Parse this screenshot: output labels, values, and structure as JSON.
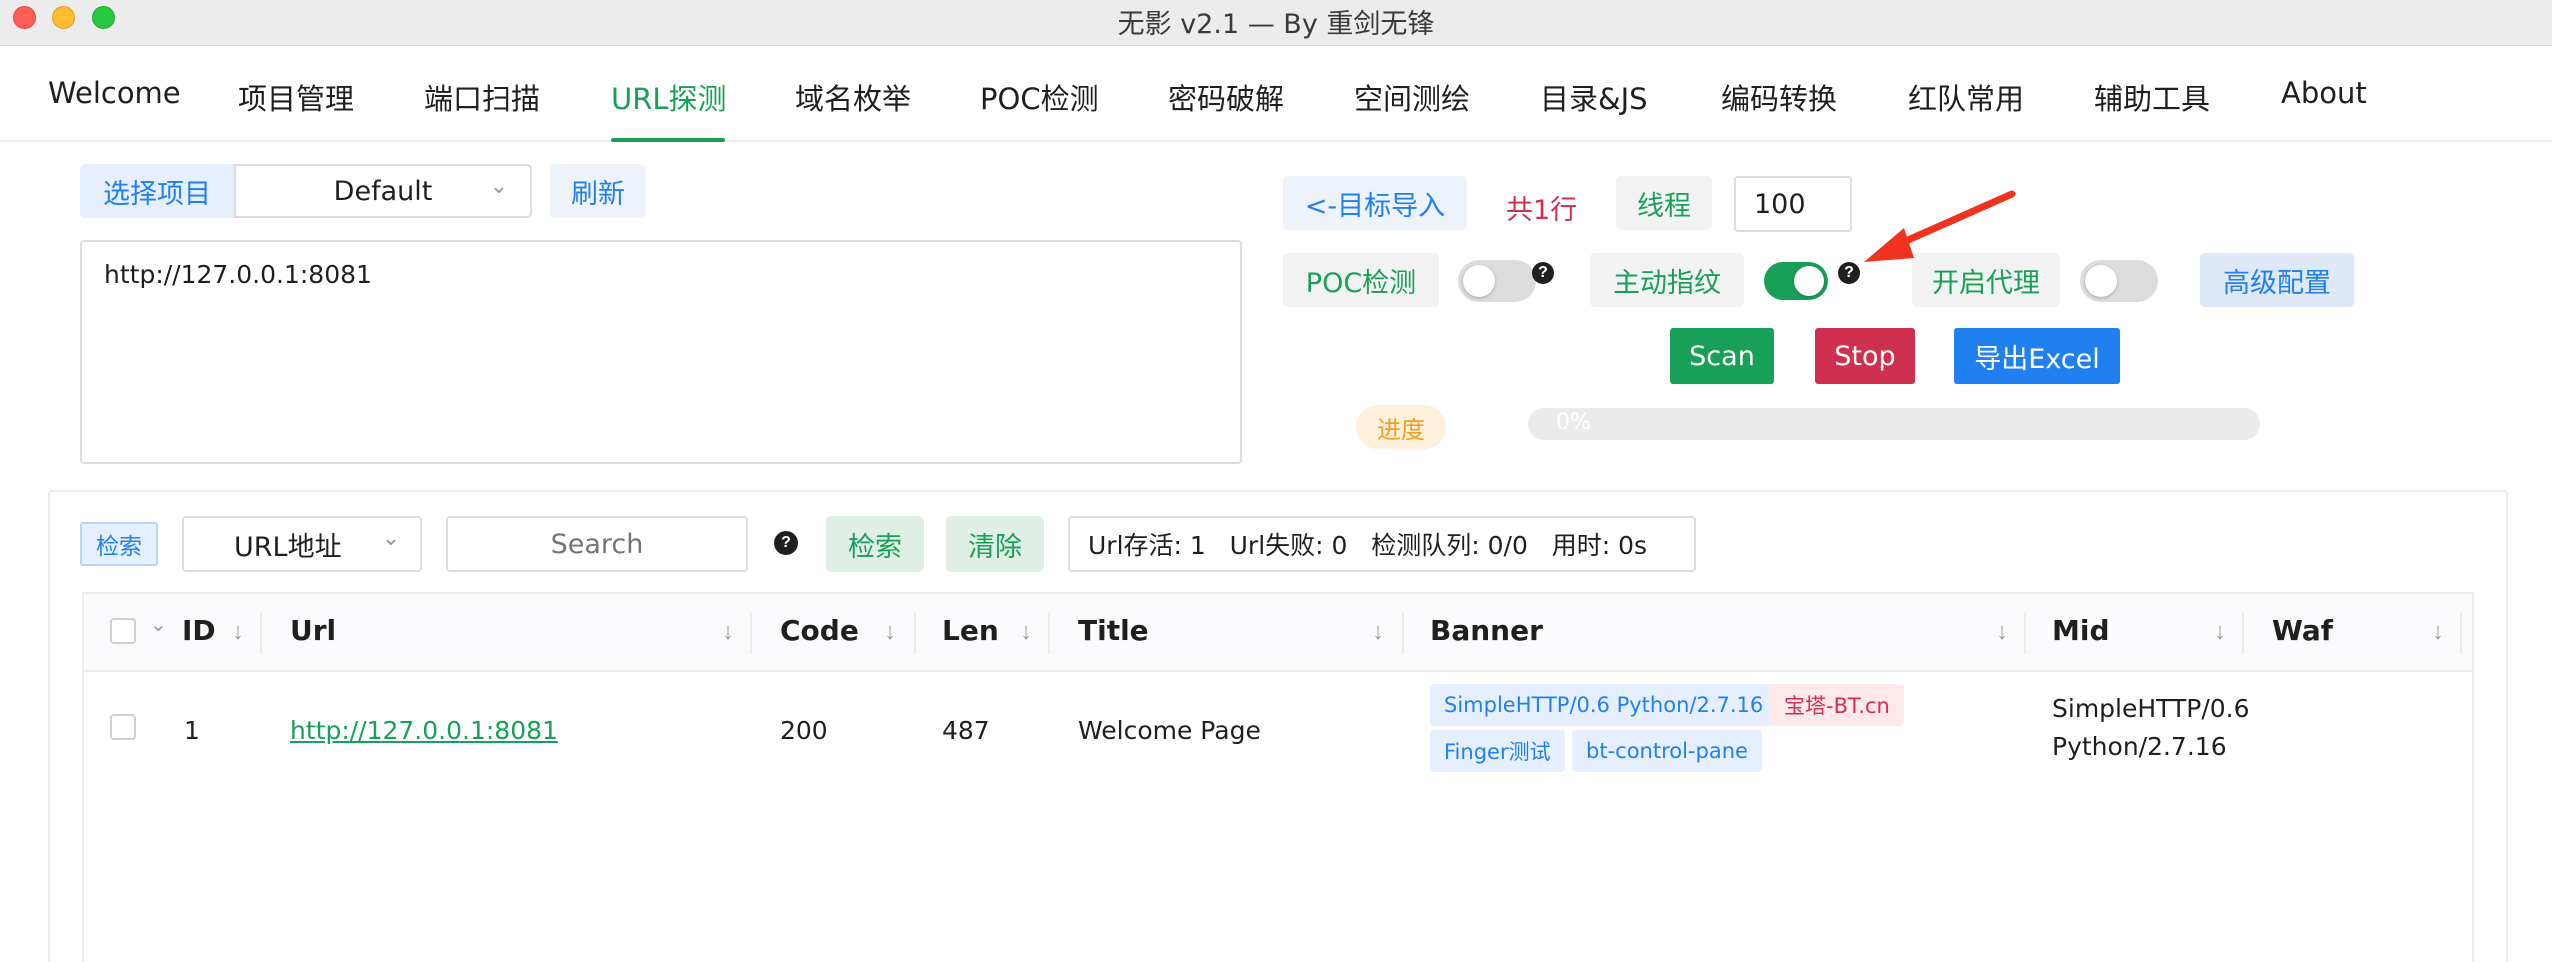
{
  "window": {
    "title": "无影 v2.1 — By 重剑无锋"
  },
  "tabs": [
    {
      "label": "Welcome"
    },
    {
      "label": "项目管理"
    },
    {
      "label": "端口扫描"
    },
    {
      "label": "URL探测"
    },
    {
      "label": "域名枚举"
    },
    {
      "label": "POC检测"
    },
    {
      "label": "密码破解"
    },
    {
      "label": "空间测绘"
    },
    {
      "label": "目录&JS"
    },
    {
      "label": "编码转换"
    },
    {
      "label": "红队常用"
    },
    {
      "label": "辅助工具"
    },
    {
      "label": "About"
    }
  ],
  "active_tab": "URL探测",
  "project": {
    "select_label": "选择项目",
    "selected": "Default",
    "refresh_label": "刷新"
  },
  "targets": {
    "text": "http://127.0.0.1:8081"
  },
  "controls": {
    "import_label": "<-目标导入",
    "line_count": "共1行",
    "threads_label": "线程",
    "threads_value": "100",
    "poc_label": "POC检测",
    "poc_enabled": false,
    "fingerprint_label": "主动指纹",
    "fingerprint_enabled": true,
    "proxy_label": "开启代理",
    "proxy_enabled": false,
    "advanced_label": "高级配置",
    "scan_label": "Scan",
    "stop_label": "Stop",
    "export_label": "导出Excel",
    "progress_label": "进度",
    "progress_text": "0%",
    "progress_value": 0
  },
  "filter": {
    "tag_label": "检索",
    "field_selected": "URL地址",
    "search_placeholder": "Search",
    "search_button": "检索",
    "clear_button": "清除",
    "stats": "Url存活: 1   Url失败: 0   检测队列: 0/0   用时: 0s"
  },
  "table": {
    "columns": [
      "ID",
      "Url",
      "Code",
      "Len",
      "Title",
      "Banner",
      "Mid",
      "Waf"
    ],
    "rows": [
      {
        "id": "1",
        "url": "http://127.0.0.1:8081",
        "code": "200",
        "len": "487",
        "title": "Welcome Page",
        "banner_tags": [
          {
            "text": "SimpleHTTP/0.6 Python/2.7.16",
            "color": "blue"
          },
          {
            "text": "宝塔-BT.cn",
            "color": "red"
          },
          {
            "text": "Finger测试",
            "color": "blue"
          },
          {
            "text": "bt-control-pane",
            "color": "blue"
          }
        ],
        "mid_line1": "SimpleHTTP/0.6",
        "mid_line2": "Python/2.7.16",
        "waf": ""
      }
    ]
  },
  "colors": {
    "accent": "#18a058",
    "primary": "#2080f0",
    "danger": "#d03050",
    "warning": "#f0a020"
  }
}
